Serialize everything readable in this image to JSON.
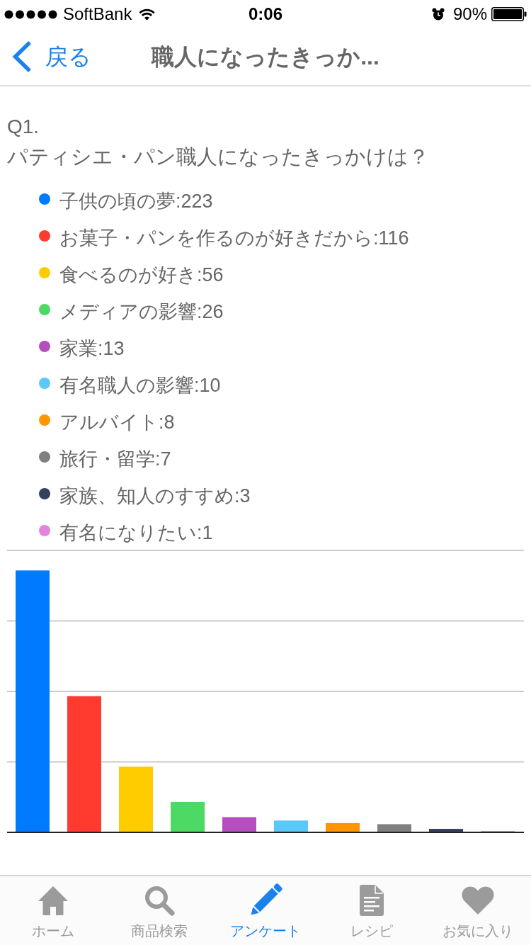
{
  "status_bar": {
    "carrier": "SoftBank",
    "time": "0:06",
    "battery": "90%"
  },
  "nav_bar": {
    "back": "戻る",
    "title": "職人になったきっか..."
  },
  "question": {
    "number": "Q1.",
    "text": "パティシエ・パン職人になったきっかけは？"
  },
  "legend": [
    {
      "label": "子供の頃の夢:223",
      "color": "#007aff"
    },
    {
      "label": "お菓子・パンを作るのが好きだから:116",
      "color": "#ff3b30"
    },
    {
      "label": "食べるのが好き:56",
      "color": "#ffcc00"
    },
    {
      "label": "メディアの影響:26",
      "color": "#4cd964"
    },
    {
      "label": "家業:13",
      "color": "#b44fbd"
    },
    {
      "label": "有名職人の影響:10",
      "color": "#5ac8fa"
    },
    {
      "label": "アルバイト:8",
      "color": "#ff9500"
    },
    {
      "label": "旅行・留学:7",
      "color": "#808080"
    },
    {
      "label": "家族、知人のすすめ:3",
      "color": "#34405e"
    },
    {
      "label": "有名になりたい:1",
      "color": "#e384e0"
    }
  ],
  "tab_bar": [
    {
      "label": "ホーム",
      "selected": false
    },
    {
      "label": "商品検索",
      "selected": false
    },
    {
      "label": "アンケート",
      "selected": true
    },
    {
      "label": "レシピ",
      "selected": false
    },
    {
      "label": "お気に入り",
      "selected": false
    }
  ]
}
